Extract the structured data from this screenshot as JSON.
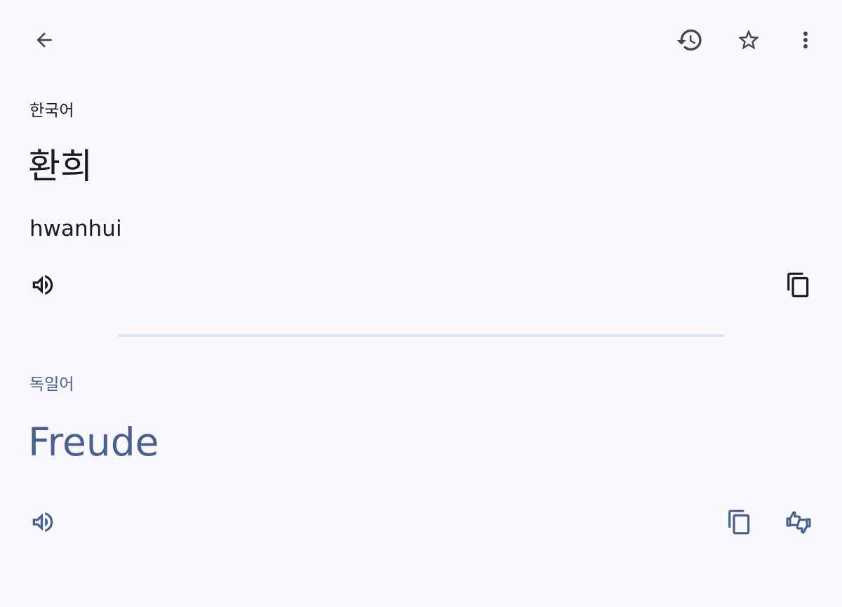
{
  "top_bar": {
    "back_icon": "arrow-back-icon",
    "history_icon": "history-icon",
    "star_icon": "star-outline-icon",
    "more_icon": "more-vert-icon"
  },
  "source": {
    "language": "한국어",
    "text": "환희",
    "transliteration": "hwanhui",
    "speak_icon": "volume-up-icon",
    "copy_icon": "copy-icon"
  },
  "target": {
    "language": "독일어",
    "text": "Freude",
    "speak_icon": "volume-up-icon",
    "copy_icon": "copy-icon",
    "feedback_icon": "rate-translation-icon"
  },
  "colors": {
    "background": "#f8f8fd",
    "primary_text": "#1b1b1f",
    "accent": "#48608e",
    "divider": "#dfe3f1"
  }
}
